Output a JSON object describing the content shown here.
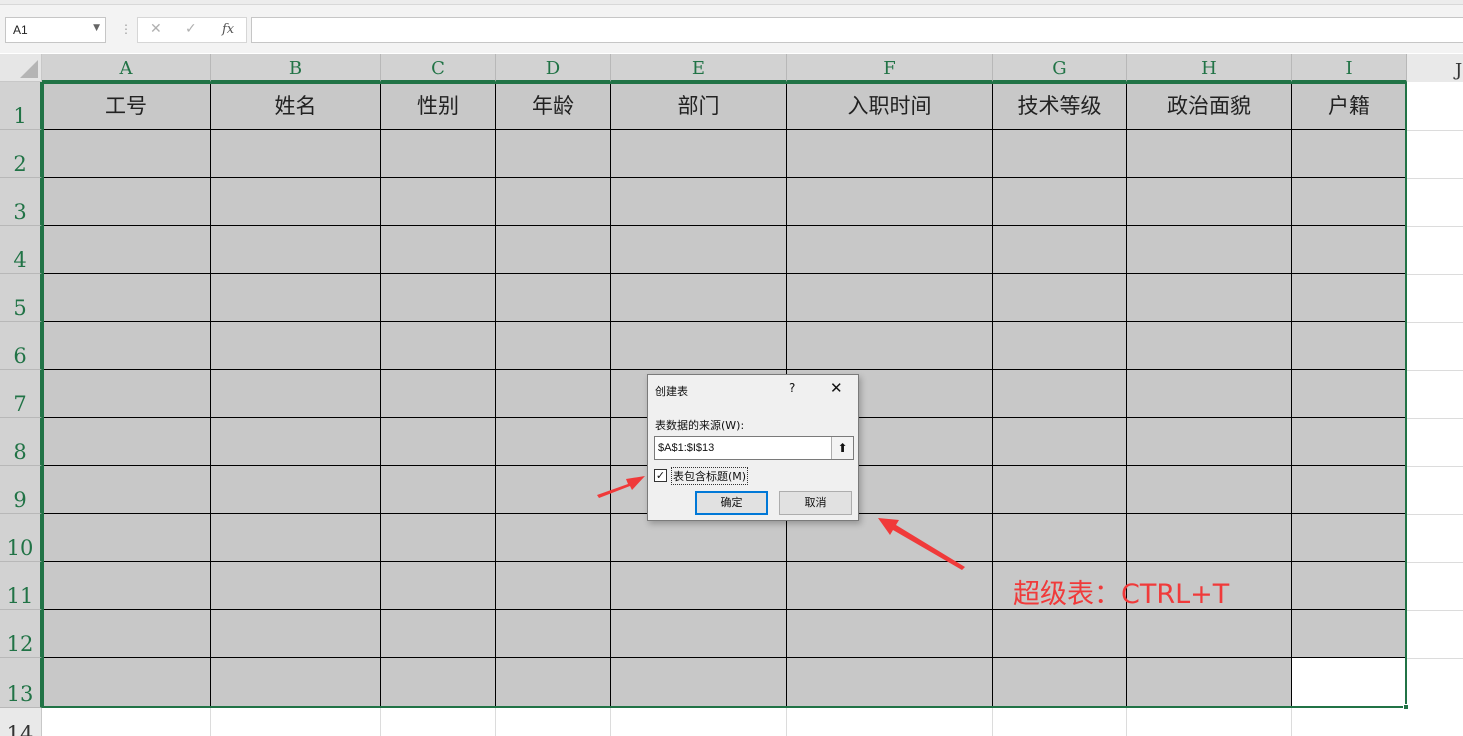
{
  "formula_bar": {
    "name_box": "A1",
    "cancel_icon": "✕",
    "enter_icon": "✓",
    "fx_label": "fx",
    "formula": ""
  },
  "columns": [
    "A",
    "B",
    "C",
    "D",
    "E",
    "F",
    "G",
    "H",
    "I"
  ],
  "offscreen_column": "J",
  "rows": [
    "1",
    "2",
    "3",
    "4",
    "5",
    "6",
    "7",
    "8",
    "9",
    "10",
    "11",
    "12",
    "13"
  ],
  "offscreen_row": "14",
  "table": {
    "headers": [
      "工号",
      "姓名",
      "性别",
      "年龄",
      "部门",
      "入职时间",
      "技术等级",
      "政治面貌",
      "户籍"
    ]
  },
  "dialog": {
    "title": "创建表",
    "help": "?",
    "close": "✕",
    "source_label": "表数据的来源(W):",
    "range_value": "$A$1:$I$13",
    "collapse_icon": "🡅",
    "checkbox_checked": true,
    "checkbox_mark": "✓",
    "checkbox_label": "表包含标题(M)",
    "ok_label": "确定",
    "cancel_label": "取消"
  },
  "annotation": {
    "text": "超级表：CTRL+T",
    "color": "#f03a3a"
  },
  "colors": {
    "accent": "#217346",
    "cell_fill": "#c8c8c8"
  }
}
